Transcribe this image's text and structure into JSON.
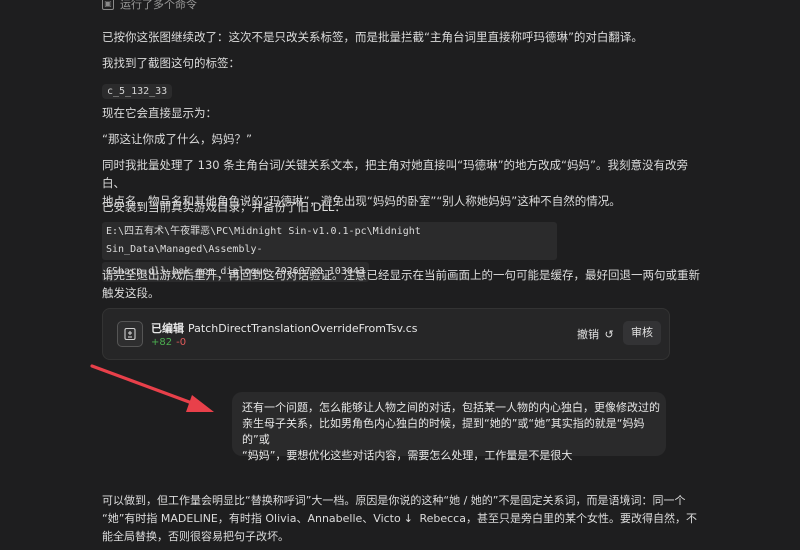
{
  "top_status": "运行了多个命令",
  "reply": {
    "p1": "已按你这张图继续改了：这次不是只改关系标签，而是批量拦截“主角台词里直接称呼玛德琳”的对白翻译。",
    "p2": "我找到了截图这句的标签：",
    "tag": "c_5_132_33",
    "p3": "现在它会直接显示为：",
    "quote": "“那这让你成了什么，妈妈？”",
    "p4_line1": "同时我批量处理了 130 条主角台词/关键关系文本，把主角对她直接叫“玛德琳”的地方改成“妈妈”。我刻意没有改旁白、",
    "p4_line2": "地点名、物品名和其他角色说的“玛德琳”，避免出现“妈妈的卧室”“别人称她妈妈”这种不自然的情况。",
    "p5": "已安装到当前真实游戏目录，并备份了旧 DLL：",
    "path_line1": "E:\\四五有术\\午夜罪恶\\PC\\Midnight Sin-v1.0.1-pc\\Midnight Sin_Data\\Managed\\Assembly-",
    "path_line2": "CSharp.dll.bak_mom_dialogue_20260720_103043",
    "p6_line1": "请完全退出游戏后重开，再回到这句对话验证。注意已经显示在当前画面上的一句可能是缓存，最好回退一两句或重新",
    "p6_line2": "触发这段。"
  },
  "file_card": {
    "action": "已编辑",
    "filename": "PatchDirectTranslationOverrideFromTsv.cs",
    "added": "+82",
    "removed": "-0",
    "undo_label": "撤销",
    "review_label": "审核"
  },
  "user_message": {
    "line1": "还有一个问题，怎么能够让人物之间的对话，包括某一人物的内心独白，更像修改过的",
    "line2": "亲生母子关系，比如男角色内心独白的时候，提到“她的”或“她”其实指的就是“妈妈的”或",
    "line3": "“妈妈”，要想优化这些对话内容，需要怎么处理，工作量是不是很大"
  },
  "response2": {
    "line1": "可以做到，但工作量会明显比“替换称呼词”大一档。原因是你说的这种“她 / 她的”不是固定关系词，而是语境词：同一个",
    "line2": "“她”有时指 MADELINE，有时指 Olivia、Annabelle、Victo",
    "line2b": " Rebecca，甚至只是旁白里的某个女性。要改得自然，不",
    "line3": "能全局替换，否则很容易把句子改坏。"
  },
  "colors": {
    "background": "#1e1e1f",
    "arrow": "#e8404a",
    "added": "#4caf50",
    "removed": "#e05a5a"
  }
}
